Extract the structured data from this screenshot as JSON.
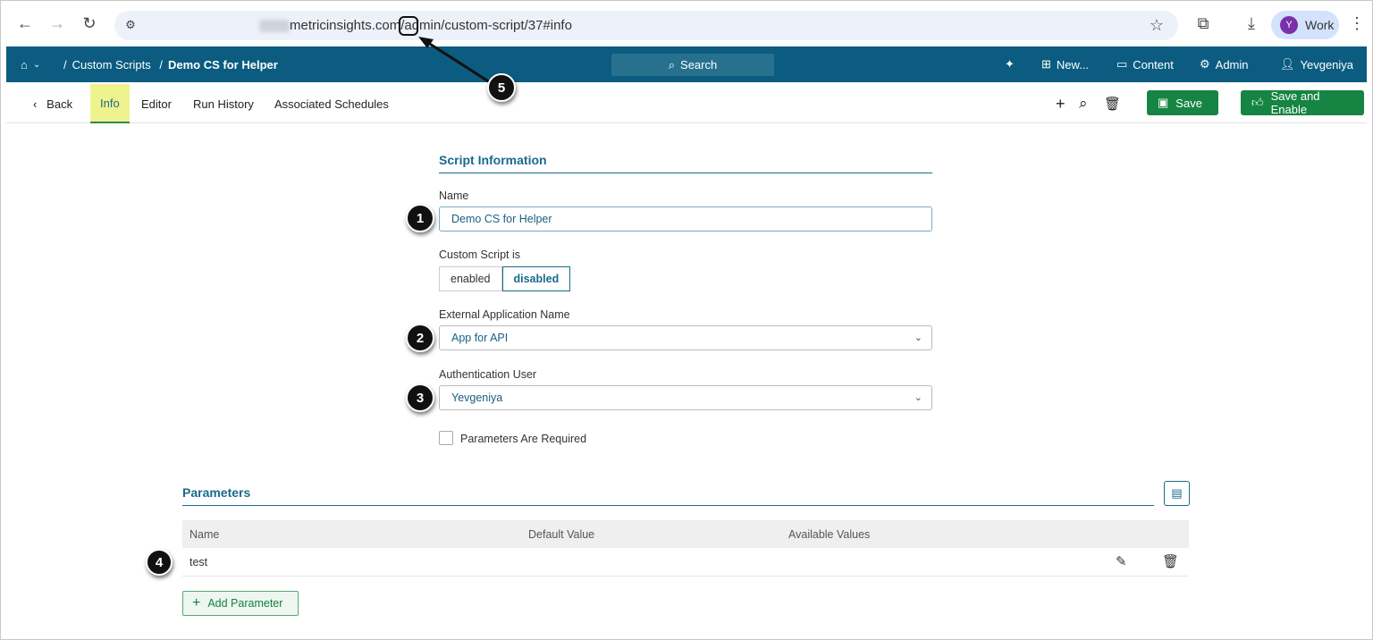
{
  "browser": {
    "url_domain": "metricinsights.com/admin/custom-script/37#info",
    "profile_initial": "Y",
    "profile_label": "Work"
  },
  "nav": {
    "breadcrumb": [
      "Custom Scripts",
      "Demo CS for Helper"
    ],
    "search_label": "Search",
    "new_label": "New...",
    "content_label": "Content",
    "admin_label": "Admin",
    "user_label": "Yevgeniya"
  },
  "tabs": {
    "back": "Back",
    "items": [
      "Info",
      "Editor",
      "Run History",
      "Associated Schedules"
    ],
    "save": "Save",
    "save_enable": "Save and Enable"
  },
  "form": {
    "section_title": "Script Information",
    "name_label": "Name",
    "name_value": "Demo CS for Helper",
    "status_label": "Custom Script is",
    "status_options": [
      "enabled",
      "disabled"
    ],
    "status_selected": "disabled",
    "app_label": "External Application Name",
    "app_value": "App for API",
    "user_label": "Authentication User",
    "user_value": "Yevgeniya",
    "params_required_label": "Parameters Are Required",
    "params_required": false
  },
  "parameters": {
    "title": "Parameters",
    "columns": [
      "Name",
      "Default Value",
      "Available Values"
    ],
    "rows": [
      {
        "name": "test",
        "default": "",
        "available": ""
      }
    ],
    "add_label": "Add Parameter"
  },
  "callouts": [
    "1",
    "2",
    "3",
    "4",
    "5"
  ]
}
